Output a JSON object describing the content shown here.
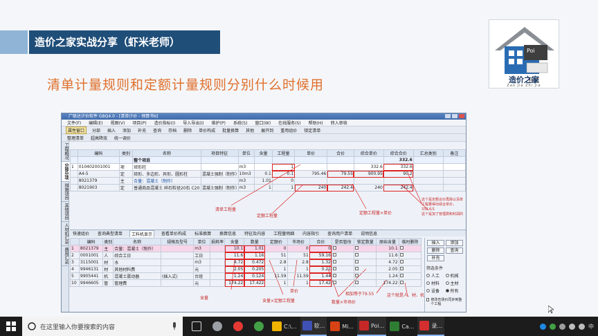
{
  "slide": {
    "header_title": "造价之家实战分享（虾米老师）",
    "headline": "清单计量规则和定额计量规则分别什么时候用",
    "logo": {
      "name": "造价之家",
      "sub": "Zao Jia Zhi Jia",
      "poi": "Poi",
      "start_btn": "开始"
    }
  },
  "app": {
    "title": "广联达计价软件 GBQ4.0 - [清单计价 - 预算书6]",
    "menu": [
      "文件(F)",
      "编辑(E)",
      "视图(V)",
      "项目(P)",
      "造价指标(I)",
      "导入导出(I)",
      "维护(P)",
      "系统(S)",
      "窗口(W)",
      "在线服务(S)",
      "帮助(H)",
      "转入审核"
    ],
    "toolbar": [
      "分部",
      "插入",
      "添加",
      "补充",
      "查询",
      "存档",
      "删除",
      "单价构成",
      "批量换算",
      "其他",
      "展开到",
      "重用组价",
      "锁定清单",
      "整理清单",
      "超高降效",
      "统一调价"
    ],
    "toolbar_highlight": "属性窗口",
    "side_tabs": [
      "工程概况",
      "分部分项",
      "措施项目",
      "其他项目",
      "人材机汇总",
      "费用汇总",
      "报表"
    ],
    "upper_headers": [
      "编码",
      "类别",
      "名称",
      "项目特征",
      "单位",
      "含量",
      "工程量",
      "单价",
      "合价",
      "综合单价",
      "综合合价",
      "汇总类别",
      "备注"
    ],
    "upper_rows": [
      {
        "idx": "",
        "code": "",
        "type": "",
        "name": "整个项目",
        "spec": "",
        "unit": "",
        "content": "",
        "qty": "",
        "price": "",
        "total": "",
        "uprice": "",
        "utotal": "332.6",
        "head": true
      },
      {
        "idx": "1",
        "code": "010402001001",
        "type": "项",
        "name": "矩形柱",
        "spec": "",
        "unit": "m3",
        "content": "",
        "qty": "1",
        "price": "",
        "total": "",
        "uprice": "332.6",
        "utotal": "332.6"
      },
      {
        "idx": "",
        "code": "A4-5",
        "type": "定",
        "name": "矩形、多边形、异形、圆形柱",
        "spec": "混凝土强制（制作）",
        "unit": "10m3",
        "content": "0.1",
        "qty": "0.1",
        "price": "795.46",
        "total": "79.55",
        "uprice": "900.95",
        "utotal": "90.2"
      },
      {
        "idx": "",
        "code": "8021379",
        "type": "主",
        "name": "合量：混凝土（制作）",
        "spec": "",
        "unit": "m3",
        "content": "1.01",
        "qty": "0",
        "price": "",
        "total": "",
        "uprice": "",
        "utotal": ""
      },
      {
        "idx": "",
        "code": "8021903",
        "type": "定",
        "name": "普通商品混凝土 碎石粒径20石 C20",
        "spec": "混凝土强制（制作）",
        "unit": "m3",
        "content": "1",
        "qty": "1",
        "price": "240",
        "total": "242.4",
        "uprice": "240",
        "utotal": "242.4"
      }
    ],
    "upper_annotations": {
      "a1": "清单工程量",
      "a2": "定额工程量",
      "a3": "定额工程量×单价",
      "a4": "这个是定额合价再除以清单工程量得出综合单价，332.6/1",
      "a5": "这个是加了管理费和利润的"
    },
    "lower_tabs": [
      "快速组价",
      "查询典型清单",
      "工料机显示",
      "查看单价构成",
      "标准换算",
      "换算信息",
      "特征及内容",
      "工程量明细",
      "内容指引",
      "查询用户清单",
      "说明信息"
    ],
    "lower_headers": [
      "编码",
      "类别",
      "名称",
      "规格及型号",
      "单位",
      "损耗率",
      "含量",
      "数量",
      "定额价",
      "市场价",
      "合价",
      "是否暂估",
      "锁定数量",
      "原始含量",
      "临时删除"
    ],
    "lower_rows": [
      {
        "idx": "1",
        "code": "8021379",
        "type": "主",
        "name": "合量：混凝土（制作）",
        "spec": "",
        "unit": "m3",
        "loss": "",
        "content": "10.1",
        "qty": "1.01",
        "dprice": "0",
        "mprice": "0",
        "total": "0",
        "orig": "10.1",
        "pink": true
      },
      {
        "idx": "2",
        "code": "0001001",
        "type": "人",
        "name": "综合工日",
        "spec": "",
        "unit": "工日",
        "loss": "",
        "content": "11.6",
        "qty": "1.16",
        "dprice": "51",
        "mprice": "51",
        "total": "59.16",
        "orig": "11.6"
      },
      {
        "idx": "3",
        "code": "3115001",
        "type": "材",
        "name": "水",
        "spec": "",
        "unit": "m3",
        "loss": "",
        "content": "4.72",
        "qty": "0.472",
        "dprice": "2.8",
        "mprice": "2.8",
        "total": "1.32",
        "orig": "4.72"
      },
      {
        "idx": "4",
        "code": "9946131",
        "type": "材",
        "name": "其他材料费",
        "spec": "",
        "unit": "元",
        "loss": "",
        "content": "2.05",
        "qty": "0.205",
        "dprice": "1",
        "mprice": "1",
        "total": "0.21",
        "orig": "2.05"
      },
      {
        "idx": "5",
        "code": "9905441",
        "type": "机",
        "name": "混凝土震动器",
        "spec": "(插入式)",
        "unit": "台班",
        "loss": "",
        "content": "1.24",
        "qty": "0.124",
        "dprice": "11.59",
        "mprice": "11.59",
        "total": "1.44",
        "orig": "1.24"
      },
      {
        "idx": "10",
        "code": "9946605",
        "type": "管",
        "name": "管理费",
        "spec": "",
        "unit": "元",
        "loss": "",
        "content": "174.22",
        "qty": "17.422",
        "dprice": "1",
        "mprice": "1",
        "total": "17.42",
        "orig": "174.22"
      }
    ],
    "lower_annotations": {
      "b1": "含量",
      "b2": "含量×定额工程量",
      "b3": "单价",
      "b4": "数量×市场价",
      "b5": "相加等于79.55",
      "b6": "这个就是人、材、机"
    },
    "side_panel": {
      "buttons": [
        "插入",
        "添加",
        "删除",
        "查询",
        "补充"
      ],
      "filter_title": "筛选条件",
      "options": [
        {
          "label": "人工",
          "on": false
        },
        {
          "label": "机械",
          "on": false
        },
        {
          "label": "材料",
          "on": false
        },
        {
          "label": "主材",
          "on": false
        },
        {
          "label": "设备",
          "on": false
        },
        {
          "label": "所有",
          "on": true
        }
      ],
      "checkbox_label": "修改市场价同步到整个工程"
    }
  },
  "taskbar": {
    "search_placeholder": "在这里输入你要搜索的内容",
    "apps": [
      {
        "label": "",
        "color": "#3b82c4"
      },
      {
        "label": "",
        "color": "#9aa0a6"
      },
      {
        "label": "",
        "color": "#e53935"
      },
      {
        "label": "",
        "color": "#43a047"
      },
      {
        "label": "C:\\...",
        "color": "#f0b400"
      },
      {
        "label": "软...",
        "color": "#3f51b5"
      },
      {
        "label": "Mi...",
        "color": "#d84315"
      },
      {
        "label": "Poi...",
        "color": "#c62828"
      },
      {
        "label": "Ca...",
        "color": "#2e7d32"
      },
      {
        "label": "录...",
        "color": "#d32f2f"
      }
    ],
    "time": "中"
  }
}
